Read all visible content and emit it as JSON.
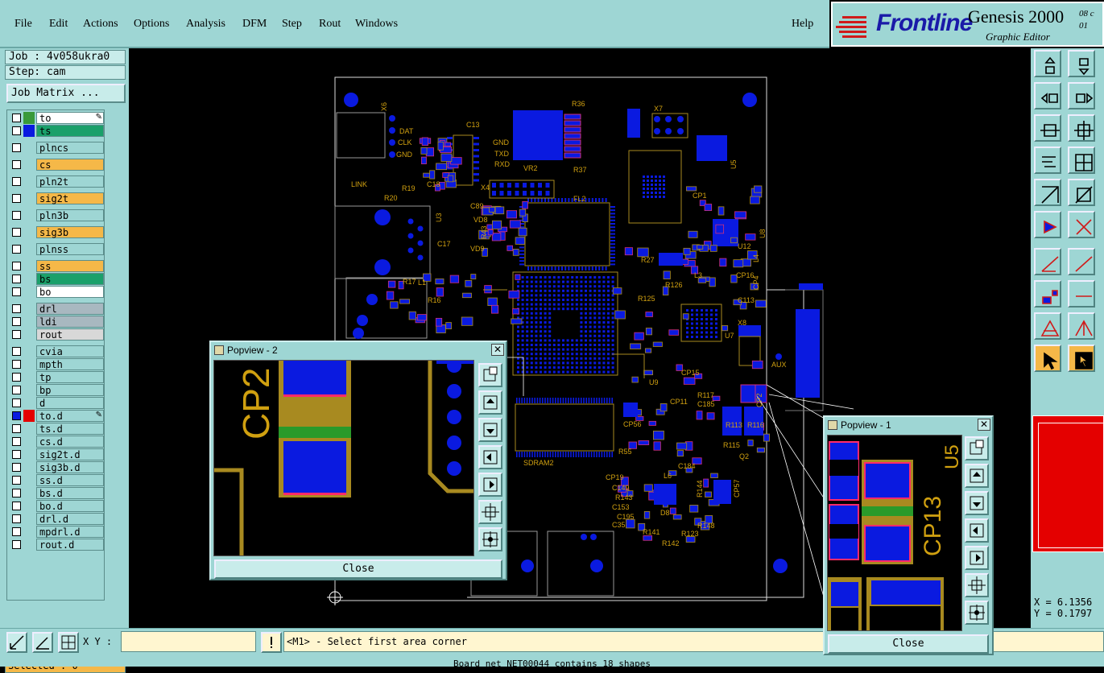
{
  "menubar": {
    "items": [
      "File",
      "Edit",
      "Actions",
      "Options",
      "Analysis",
      "DFM",
      "Step",
      "Rout",
      "Windows"
    ],
    "help": "Help"
  },
  "logo": {
    "brand": "Frontline",
    "product": "Genesis 2000",
    "subtitle": "Graphic Editor",
    "version_line1": "08 c",
    "version_line2": "01"
  },
  "job": {
    "job_label": "Job : 4v058ukra0",
    "step_label": "Step: cam",
    "matrix_button": "Job Matrix ..."
  },
  "layers": [
    {
      "name": "to",
      "color": "#3a9a3a",
      "bg": "#ffffff",
      "extra": "pencil-icon"
    },
    {
      "name": "ts",
      "color": "#0a1ae0",
      "bg": "#1aa06a"
    },
    {
      "name": "plncs",
      "color": "",
      "bg": "#9ed6d4"
    },
    {
      "name": "cs",
      "color": "",
      "bg": "#f5b848"
    },
    {
      "name": "pln2t",
      "color": "",
      "bg": "#9ed6d4"
    },
    {
      "name": "sig2t",
      "color": "",
      "bg": "#f5b848"
    },
    {
      "name": "pln3b",
      "color": "",
      "bg": "#9ed6d4"
    },
    {
      "name": "sig3b",
      "color": "",
      "bg": "#f5b848"
    },
    {
      "name": "plnss",
      "color": "",
      "bg": "#9ed6d4"
    },
    {
      "name": "ss",
      "color": "",
      "bg": "#f5b848"
    },
    {
      "name": "bs",
      "color": "",
      "bg": "#1aa06a"
    },
    {
      "name": "bo",
      "color": "",
      "bg": "#ffffff"
    },
    {
      "name": "drl",
      "color": "",
      "bg": "#a8b8c0"
    },
    {
      "name": "ldi",
      "color": "",
      "bg": "#a8b8c0"
    },
    {
      "name": "rout",
      "color": "",
      "bg": "#d8d8d8"
    },
    {
      "name": "cvia",
      "color": "",
      "bg": "#9ed6d4"
    },
    {
      "name": "mpth",
      "color": "",
      "bg": "#9ed6d4"
    },
    {
      "name": "tp",
      "color": "",
      "bg": "#9ed6d4"
    },
    {
      "name": "bp",
      "color": "",
      "bg": "#9ed6d4"
    },
    {
      "name": "d",
      "color": "",
      "bg": "#9ed6d4"
    },
    {
      "name": "to.d",
      "color": "#e40000",
      "bg": "#9ed6d4",
      "extra": "pencil-icon",
      "active": true
    },
    {
      "name": "ts.d",
      "color": "",
      "bg": "#9ed6d4"
    },
    {
      "name": "cs.d",
      "color": "",
      "bg": "#9ed6d4"
    },
    {
      "name": "sig2t.d",
      "color": "",
      "bg": "#9ed6d4"
    },
    {
      "name": "sig3b.d",
      "color": "",
      "bg": "#9ed6d4"
    },
    {
      "name": "ss.d",
      "color": "",
      "bg": "#9ed6d4"
    },
    {
      "name": "bs.d",
      "color": "",
      "bg": "#9ed6d4"
    },
    {
      "name": "bo.d",
      "color": "",
      "bg": "#9ed6d4"
    },
    {
      "name": "drl.d",
      "color": "",
      "bg": "#9ed6d4"
    },
    {
      "name": "mpdrl.d",
      "color": "",
      "bg": "#9ed6d4"
    },
    {
      "name": "rout.d",
      "color": "",
      "bg": "#9ed6d4"
    }
  ],
  "selected": "Selected : 0",
  "coords": {
    "x": "X = 6.1356",
    "y": "Y = 0.1797"
  },
  "bottombar": {
    "xy_label": "X Y :",
    "xy_value": "",
    "prompt": "<M1> - Select first area corner",
    "status": "Board net NET00044 contains 18 shapes"
  },
  "popview2": {
    "title": "Popview - 2",
    "close": "Close",
    "ref": "CP2"
  },
  "popview1": {
    "title": "Popview - 1",
    "close": "Close",
    "ref1": "CP13",
    "ref2": "U5"
  },
  "board_labels": {
    "x6": "X6",
    "dat": "DAT",
    "clk": "CLK",
    "gnd": "GND",
    "vr2": "VR2",
    "fl2": "FL2",
    "x7": "X7",
    "x4": "X4",
    "u3": "U3",
    "link": "LINK",
    "sdram": "SDRAM2",
    "aux": "AUX",
    "x8": "X8",
    "u5": "U5",
    "cp1": "CP1",
    "u8": "U8",
    "u12": "U12",
    "l3": "L3",
    "l4": "L4",
    "cp16": "CP16",
    "r36": "R36",
    "r37": "R37",
    "r19": "R19",
    "r20": "R20",
    "c18": "C18",
    "c89": "C89",
    "vd8": "VD8",
    "vd9": "VD9",
    "r43": "R43",
    "r27": "R27",
    "r125": "R125",
    "r126": "R126",
    "cp15": "CP15",
    "r113": "R113",
    "r116": "R116",
    "cp56": "CP56",
    "cp11": "CP11",
    "r55": "R55",
    "l6": "L6",
    "d8": "D8",
    "r123": "R123",
    "r142": "R142",
    "r148": "R148",
    "cp19": "CP19",
    "c149": "C149",
    "r143": "R143",
    "c153": "C153",
    "c195": "C195",
    "c35": "C35",
    "r141": "R141",
    "q2": "Q2",
    "r115": "R115",
    "c184": "C184",
    "r117": "R117",
    "c185": "C185",
    "l1": "L1",
    "r17": "R17",
    "r16": "R16",
    "cp57": "CP57",
    "r144": "R144",
    "u7": "U7",
    "u9": "U9",
    "gnd2": "GND",
    "txd": "TXD",
    "rxd": "RXD",
    "c13": "C13",
    "c17": "C17",
    "c113": "C113",
    "cp4": "CP4",
    "cp2": "CP2"
  }
}
